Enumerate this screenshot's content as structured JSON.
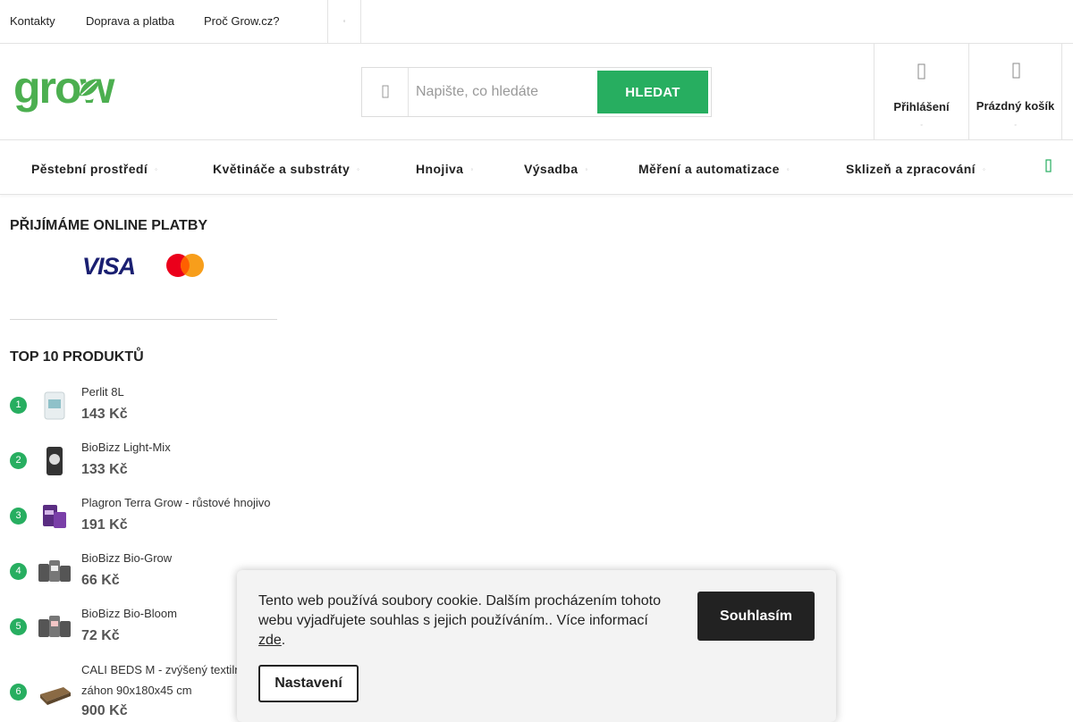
{
  "topbar": {
    "links": [
      "Kontakty",
      "Doprava a platba",
      "Proč Grow.cz?"
    ],
    "more_glyph": "◦"
  },
  "header": {
    "logo": "grow",
    "search": {
      "placeholder": "Napište, co hledáte",
      "button": "HLEDAT"
    },
    "login": {
      "label": "Přihlášení",
      "icon": "user-icon",
      "sub": "◦"
    },
    "cart": {
      "label": "Prázdný košík",
      "icon": "cart-icon",
      "sub": "◦"
    }
  },
  "nav": {
    "items": [
      {
        "label": "Pěstební prostředí",
        "arrow": "◦"
      },
      {
        "label": "Květináče a substráty",
        "arrow": "◦"
      },
      {
        "label": "Hnojiva",
        "arrow": "◦"
      },
      {
        "label": "Výsadba",
        "arrow": "◦"
      },
      {
        "label": "Měření a automatizace",
        "arrow": "◦"
      },
      {
        "label": "Sklizeň a zpracování",
        "arrow": "◦"
      }
    ]
  },
  "payments": {
    "title": "PŘIJÍMÁME ONLINE PLATBY",
    "visa": "VISA"
  },
  "top_products": {
    "title": "TOP 10 PRODUKTŮ",
    "items": [
      {
        "rank": "1",
        "name": "Perlit 8L",
        "price": "143 Kč"
      },
      {
        "rank": "2",
        "name": "BioBizz Light-Mix",
        "price": "133 Kč"
      },
      {
        "rank": "3",
        "name": "Plagron Terra Grow - růstové hnojivo",
        "price": "191 Kč"
      },
      {
        "rank": "4",
        "name": "BioBizz Bio-Grow",
        "price": "66 Kč"
      },
      {
        "rank": "5",
        "name": "BioBizz Bio-Bloom",
        "price": "72 Kč"
      },
      {
        "rank": "6",
        "name": "CALI BEDS M - zvýšený textilní záhon 90x180x45 cm",
        "price": "900 Kč"
      }
    ]
  },
  "cookie": {
    "text": "Tento web používá soubory cookie. Dalším procházením tohoto webu vyjadřujete souhlas s jejich používáním.. Více informací",
    "link": "zde",
    "period": ".",
    "agree": "Souhlasím",
    "settings": "Nastavení"
  },
  "colors": {
    "accent": "#27ae60",
    "dark": "#222222"
  }
}
